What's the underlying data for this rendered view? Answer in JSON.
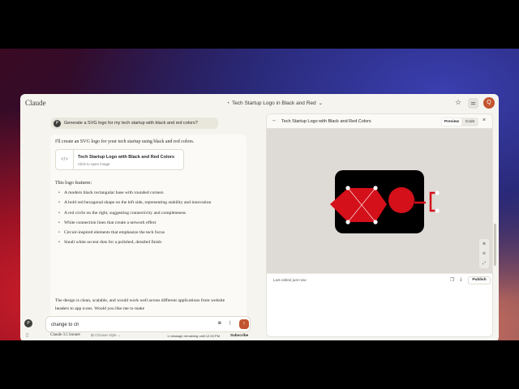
{
  "app": {
    "brand": "Claude",
    "chat_title": "Tech Startup Logo in Black and Red",
    "avatar_letter": "Q"
  },
  "conversation": {
    "user_avatar": "P",
    "user_message": "Generate a SVG logo for my tech startup with black and red colors?",
    "reply_intro": "I'll create an SVG logo for your tech startup using black and red colors.",
    "artifact": {
      "name": "Tech Startup Logo with Black and Red Colors",
      "subtitle": "Click to open image",
      "icon": "code-file-icon"
    },
    "features_heading": "This logo features:",
    "features": [
      "A modern black rectangular base with rounded corners",
      "A bold red hexagonal shape on the left side, representing stability and innovation",
      "A red circle on the right, suggesting connectivity and completeness",
      "White connection lines that create a network effect",
      "Circuit-inspired elements that emphasize the tech focus",
      "Small white accent dots for a polished, detailed finish"
    ],
    "closing": "The design is clean, scalable, and would work well across different applications from website headers to app icons. Would you like me to make"
  },
  "composer": {
    "value": "change to ch",
    "avatar": "P"
  },
  "footer": {
    "model": "Claude 3.5 Sonnet",
    "style": "Choose style",
    "limit": "1 message remaining until 12:00 PM",
    "subscribe": "Subscribe"
  },
  "artifact_panel": {
    "title": "Tech Startup Logo with Black and Red Colors",
    "tab_preview": "Preview",
    "tab_code": "Code",
    "last_edited": "Last edited just now",
    "publish": "Publish"
  },
  "colors": {
    "accent": "#c2542e",
    "logo_black": "#000000",
    "logo_red": "#d4101a"
  }
}
